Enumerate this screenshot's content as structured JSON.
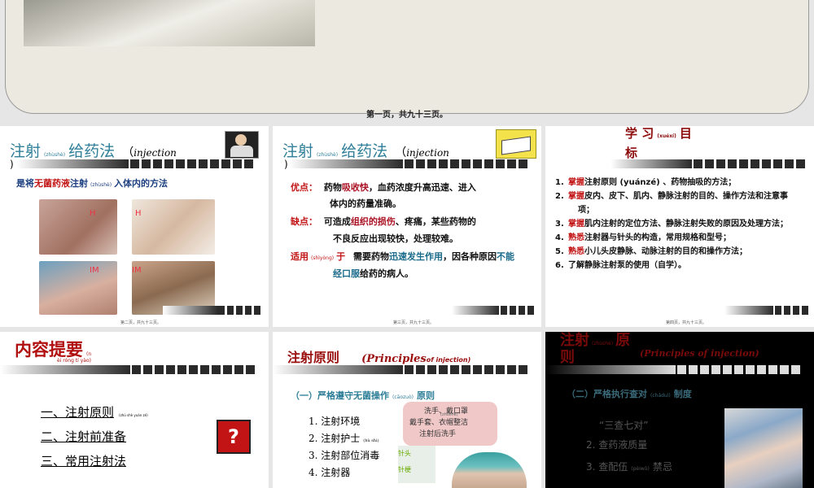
{
  "top": {
    "caption": "第一页，共九十三页。"
  },
  "s1": {
    "title": "注射",
    "ruby1": "(zhùshè)",
    "title2": "给药法",
    "paren_open": "（",
    "eng": "injection",
    "paren_close": ")",
    "def_pre": "是将",
    "def_red": "无菌药液",
    "def_mid": "注射",
    "def_ruby": "(zhùshè)",
    "def_post": "入体内的方法",
    "lbl_h1": "H",
    "lbl_h2": "H",
    "lbl_im1": "IM",
    "lbl_im2": "IM",
    "foot": "第二页，共九十三页。"
  },
  "s2": {
    "title": "注射",
    "ruby1": "(zhùshè)",
    "title2": "给药法",
    "paren_open": "（",
    "eng": "injection",
    "paren_close": ")",
    "adv_label": "优点：",
    "adv_a": "药物",
    "adv_b": "吸收快",
    "adv_c": "，血药浓度升高迅速、进入",
    "adv_2": "体内的药量准确。",
    "dis_label": "缺点：",
    "dis_a": "可造成",
    "dis_b": "组织的损伤",
    "dis_c": "、疼痛，某些药物的",
    "dis_2": "不良反应出现较快，处理较难。",
    "use_label": "适用",
    "use_ruby": "(shìyòng)",
    "use_yu": "于",
    "use_a": "需要药物",
    "use_b": "迅速发生作用",
    "use_c": "，因各种原因",
    "use_d": "不能",
    "use_2": "经口服",
    "use_3": "给药的病人。",
    "foot": "第三页，共九十三页。"
  },
  "s3": {
    "title_a": "学 习",
    "title_ruby": "(xuéxí)",
    "title_b": "目",
    "title_c": "标",
    "items": [
      {
        "n": "1.",
        "hl": "掌握",
        "t": "注射原则 (yuánzé) 、药物抽吸的方法；"
      },
      {
        "n": "2.",
        "hl": "掌握",
        "t": "皮内、皮下、肌内、静脉注射的目的、操作方法和注意事"
      },
      {
        "n": "",
        "hl": "",
        "t": "项；"
      },
      {
        "n": "3.",
        "hl": "掌握",
        "t": "肌内注射的定位方法、静脉注射失败的原因及处理方法；"
      },
      {
        "n": "4.",
        "hl": "熟悉",
        "t": "注射器与针头的构造，常用规格和型号；"
      },
      {
        "n": "5.",
        "hl": "熟悉",
        "t": "小儿头皮静脉、动脉注射的目的和操作方法；"
      },
      {
        "n": "6.",
        "hl": "",
        "t": "了解静脉注射泵的使用（自学）。"
      }
    ],
    "foot": "第四页，共九十三页。"
  },
  "s4": {
    "title": "内容提要",
    "ruby": "(n",
    "ruby2": "èi róng tí yào)",
    "items": [
      "一、注射原则",
      "二、注射前准备",
      "三、常用注射法"
    ],
    "item1_ruby": "(zhù shè yuán zé)"
  },
  "s5": {
    "title": "注射原则",
    "eng_a": "(Principles",
    "eng_b": "of injection)",
    "sub": "（一）严格遵守无菌操作",
    "sub_ruby": "(cāozuò)",
    "sub_end": "原则",
    "items": [
      "1. 注射环境",
      "2. 注射护士",
      "3. 注射部位消毒",
      "4. 注射器"
    ],
    "item2_ruby": "(hù shi)",
    "bubble1": "洗手、戴口罩",
    "bubble2": "戴手套、衣帽整洁",
    "bubble3": "注射后洗手",
    "bubble_ruby": "(zhùshè)",
    "tag1": "针头",
    "tag2": "针梗"
  },
  "s6": {
    "title_a": "注射",
    "title_ruby": "(zhùshè)",
    "title_b": "原",
    "title_c": "则",
    "eng": "(Principles of injection)",
    "sub": "（二）严格执行查对",
    "sub_ruby": "(cháduì)",
    "sub_end": "制度",
    "quote": "“三查七对”",
    "items": [
      "2.  查药液质量",
      "3.  查配伍"
    ],
    "item_ruby": "(pèiwǔ)",
    "item3_end": "禁忌"
  }
}
